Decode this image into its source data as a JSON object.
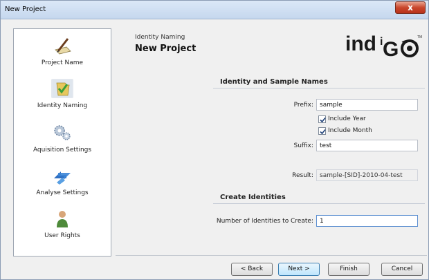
{
  "window": {
    "title": "New Project",
    "close_label": "x"
  },
  "nav": {
    "items": [
      {
        "label": "Project Name",
        "icon": "pen-and-paper-icon"
      },
      {
        "label": "Identity Naming",
        "icon": "folder-check-icon"
      },
      {
        "label": "Aquisition Settings",
        "icon": "gears-icon"
      },
      {
        "label": "Analyse Settings",
        "icon": "arrows-icon"
      },
      {
        "label": "User Rights",
        "icon": "user-icon"
      }
    ],
    "active_index": 1
  },
  "header": {
    "subtitle": "Identity Naming",
    "title": "New Project",
    "logo_text": "indiGO"
  },
  "identity_section": {
    "title": "Identity and Sample Names",
    "prefix_label": "Prefix:",
    "prefix_value": "sample",
    "include_year_label": "Include Year",
    "include_year_checked": true,
    "include_month_label": "Include Month",
    "include_month_checked": true,
    "suffix_label": "Suffix:",
    "suffix_value": "test",
    "result_label": "Result:",
    "result_value": "sample-[SID]-2010-04-test"
  },
  "create_section": {
    "title": "Create Identities",
    "count_label": "Number of Identities to Create:",
    "count_value": "1"
  },
  "buttons": {
    "back": "< Back",
    "next": "Next >",
    "finish": "Finish",
    "cancel": "Cancel"
  },
  "colors": {
    "accent": "#3c7fb1",
    "close": "#c9462c"
  }
}
